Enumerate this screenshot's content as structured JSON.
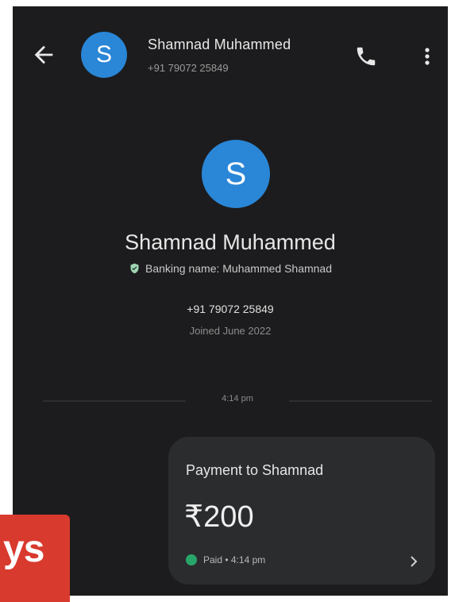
{
  "header": {
    "contact_name": "Shamnad Muhammed",
    "contact_phone": "+91 79072 25849",
    "avatar_initial": "S",
    "icons": [
      "back-arrow-icon",
      "phone-icon",
      "more-vert-icon"
    ]
  },
  "profile": {
    "avatar_initial": "S",
    "name": "Shamnad Muhammed",
    "banking_name": "Banking name: Muhammed Shamnad",
    "phone": "+91 79072 25849",
    "joined": "Joined June 2022"
  },
  "timeline": {
    "divider_time": "4:14 pm"
  },
  "payment_card": {
    "title": "Payment to Shamnad",
    "amount": "₹200",
    "status": "Paid • 4:14 pm"
  },
  "overlay": {
    "text": "ys"
  },
  "colors": {
    "background": "#1c1c1e",
    "avatar": "#2a86d6",
    "card": "#2b2c2e",
    "paid": "#28a66a",
    "overlay": "#d93a2e"
  }
}
